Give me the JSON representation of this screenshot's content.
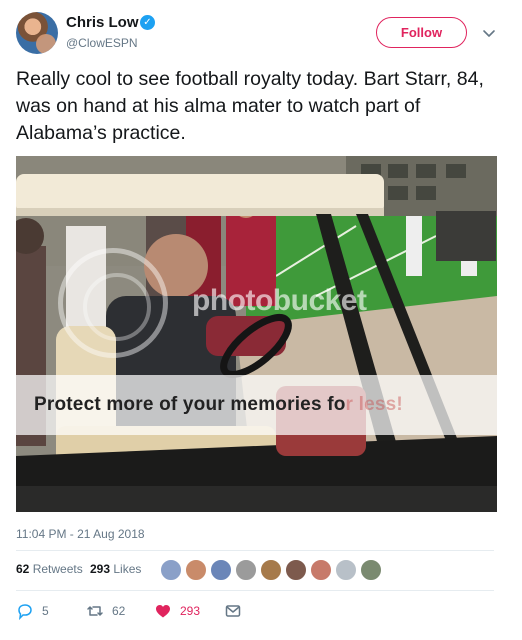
{
  "author": {
    "name": "Chris Low",
    "handle": "@ClowESPN",
    "verified_icon": "verified-badge-icon"
  },
  "follow_button": {
    "label": "Follow"
  },
  "tweet": {
    "text": "Really cool to see football royalty today. Bart Starr, 84, was on hand at his alma mater to watch part of Alabama’s practice.",
    "timestamp": "11:04 PM - 21 Aug 2018"
  },
  "media": {
    "watermark_brand": "photobucket",
    "watermark_message_main": "Protect more of your memories fo",
    "watermark_message_faded": "r less!"
  },
  "stats": {
    "retweets_count": "62",
    "retweets_label": "Retweets",
    "likes_count": "293",
    "likes_label": "Likes"
  },
  "actions": {
    "reply_count": "5",
    "retweet_count": "62",
    "like_count": "293"
  },
  "colors": {
    "accent": "#e0245e",
    "verified": "#1da1f2",
    "muted": "#657786"
  }
}
